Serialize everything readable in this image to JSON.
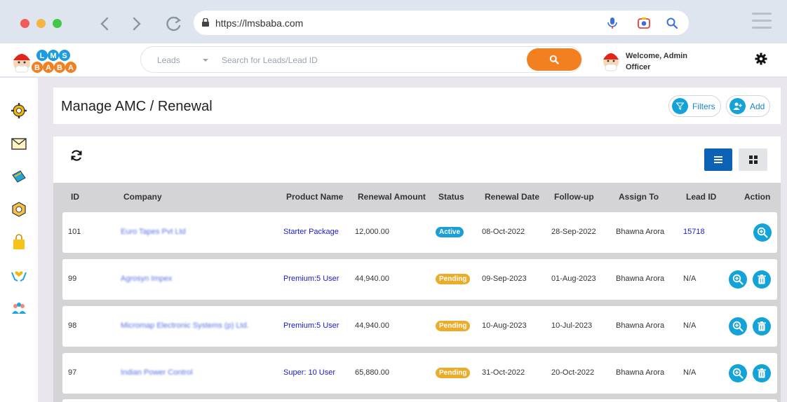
{
  "browser": {
    "url": "https://lmsbaba.com"
  },
  "header": {
    "search_category": "Leads",
    "search_placeholder": "Search for Leads/Lead ID",
    "welcome_line1": "Welcome, Admin",
    "welcome_line2": "Officer",
    "logo_text": "LMS BABA"
  },
  "page": {
    "title": "Manage AMC / Renewal",
    "filters_label": "Filters",
    "add_label": "Add"
  },
  "table": {
    "columns": [
      "ID",
      "Company",
      "Product Name",
      "Renewal Amount",
      "Status",
      "Renewal Date",
      "Follow-up",
      "Assign To",
      "Lead ID",
      "Action"
    ],
    "rows": [
      {
        "id": "101",
        "company": "Euro Tapes Pvt Ltd",
        "product": "Starter Package",
        "amount": "12,000.00",
        "status": "Active",
        "renewal_date": "08-Oct-2022",
        "followup": "28-Sep-2022",
        "assign_to": "Bhawna Arora",
        "lead_id": "15718"
      },
      {
        "id": "99",
        "company": "Agrosyn Impex",
        "product": "Premium:5 User",
        "amount": "44,940.00",
        "status": "Pending",
        "renewal_date": "09-Sep-2023",
        "followup": "01-Aug-2023",
        "assign_to": "Bhawna Arora",
        "lead_id": "N/A"
      },
      {
        "id": "98",
        "company": "Micromap Electronic Systems (p) Ltd.",
        "product": "Premium:5 User",
        "amount": "44,940.00",
        "status": "Pending",
        "renewal_date": "10-Aug-2023",
        "followup": "10-Jul-2023",
        "assign_to": "Bhawna Arora",
        "lead_id": "N/A"
      },
      {
        "id": "97",
        "company": "Indian Power Control",
        "product": "Super: 10 User",
        "amount": "65,880.00",
        "status": "Pending",
        "renewal_date": "31-Oct-2022",
        "followup": "20-Oct-2022",
        "assign_to": "Bhawna Arora",
        "lead_id": "N/A"
      }
    ]
  },
  "colors": {
    "accent_orange": "#f28020",
    "accent_blue": "#14a3d9",
    "active_badge": "#1a9fd9",
    "pending_badge": "#ecab28",
    "link": "#1a1ad0"
  },
  "sidebar_icons": [
    "settings-icon",
    "mail-icon",
    "ticket-icon",
    "package-icon",
    "shopping-bag-icon",
    "care-icon",
    "team-icon"
  ]
}
